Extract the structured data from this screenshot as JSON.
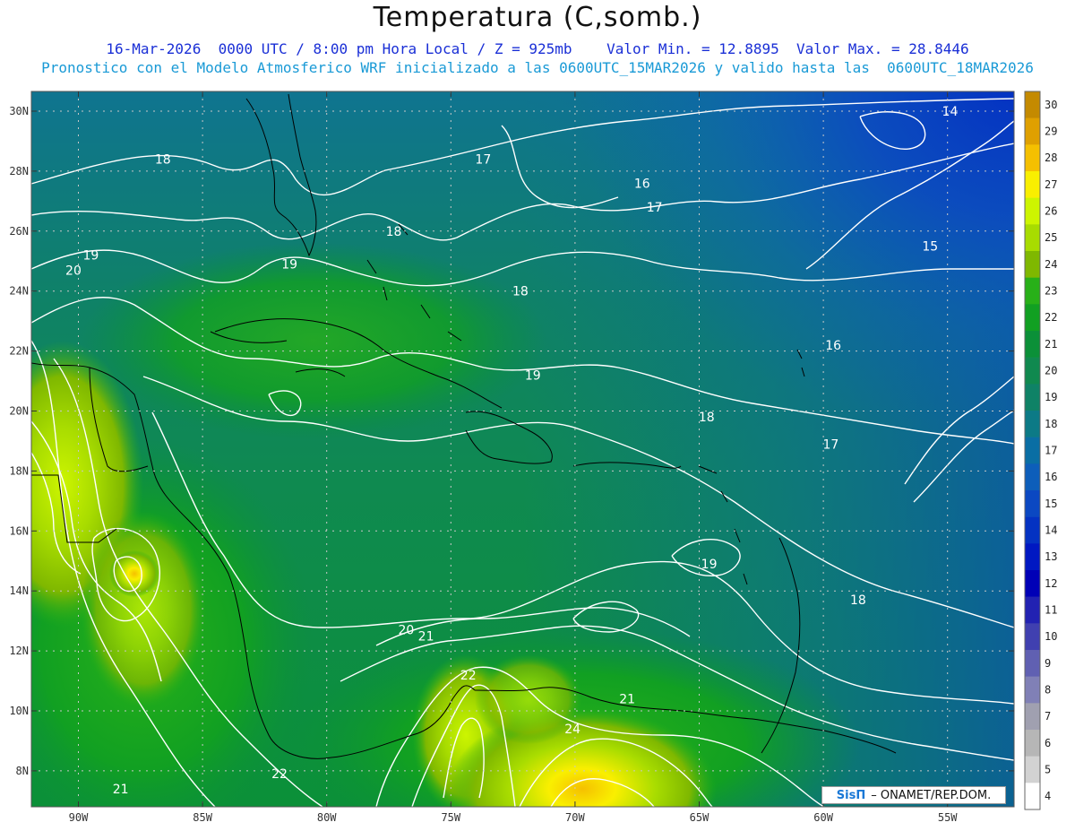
{
  "header": {
    "title": "Temperatura (C,somb.)",
    "line1": "16-Mar-2026  0000 UTC / 8:00 pm Hora Local / Z = 925mb    Valor Min. = 12.8895  Valor Max. = 28.8446",
    "line2": "Pronostico con el Modelo Atmosferico WRF inicializado a las 0600UTC_15MAR2026 y valido hasta las  0600UTC_18MAR2026"
  },
  "map": {
    "lat_ticks": [
      "30N",
      "28N",
      "26N",
      "24N",
      "22N",
      "20N",
      "18N",
      "16N",
      "14N",
      "12N",
      "10N",
      "8N"
    ],
    "lon_ticks": [
      "90W",
      "85W",
      "80W",
      "75W",
      "70W",
      "65W",
      "60W",
      "55W"
    ],
    "contour_labels": [
      {
        "text": "14",
        "lon": -54.9,
        "lat": 30.0
      },
      {
        "text": "15",
        "lon": -55.7,
        "lat": 25.5
      },
      {
        "text": "16",
        "lon": -67.3,
        "lat": 27.6
      },
      {
        "text": "16",
        "lon": -59.6,
        "lat": 22.2
      },
      {
        "text": "17",
        "lon": -73.7,
        "lat": 28.4
      },
      {
        "text": "17",
        "lon": -66.8,
        "lat": 26.8
      },
      {
        "text": "17",
        "lon": -59.7,
        "lat": 18.9
      },
      {
        "text": "18",
        "lon": -86.6,
        "lat": 28.4
      },
      {
        "text": "18",
        "lon": -77.3,
        "lat": 26.0
      },
      {
        "text": "18",
        "lon": -72.2,
        "lat": 24.0
      },
      {
        "text": "18",
        "lon": -64.7,
        "lat": 19.8
      },
      {
        "text": "18",
        "lon": -58.6,
        "lat": 13.7
      },
      {
        "text": "19",
        "lon": -89.5,
        "lat": 25.2
      },
      {
        "text": "19",
        "lon": -81.5,
        "lat": 24.9
      },
      {
        "text": "19",
        "lon": -71.7,
        "lat": 21.2
      },
      {
        "text": "19",
        "lon": -64.6,
        "lat": 14.9
      },
      {
        "text": "20",
        "lon": -90.2,
        "lat": 24.7
      },
      {
        "text": "20",
        "lon": -76.8,
        "lat": 12.7
      },
      {
        "text": "21",
        "lon": -76.0,
        "lat": 12.5
      },
      {
        "text": "21",
        "lon": -88.3,
        "lat": 7.4
      },
      {
        "text": "21",
        "lon": -67.9,
        "lat": 10.4
      },
      {
        "text": "22",
        "lon": -74.3,
        "lat": 11.2
      },
      {
        "text": "22",
        "lon": -81.9,
        "lat": 7.9
      },
      {
        "text": "24",
        "lon": -70.1,
        "lat": 9.4
      }
    ]
  },
  "colorbar": {
    "labels": [
      "30",
      "29",
      "28",
      "27",
      "26",
      "25",
      "24",
      "23",
      "22",
      "21",
      "20",
      "19",
      "18",
      "17",
      "16",
      "15",
      "14",
      "13",
      "12",
      "11",
      "10",
      "9",
      "8",
      "7",
      "6",
      "5",
      "4"
    ],
    "colors": [
      "#c48a00",
      "#dfa000",
      "#f5c000",
      "#f9ef00",
      "#cdf500",
      "#a8dc00",
      "#7fb800",
      "#28b018",
      "#11a022",
      "#0b9038",
      "#10894f",
      "#0f8266",
      "#0c7a86",
      "#0a6ea4",
      "#0d5eba",
      "#0b48c2",
      "#0432c2",
      "#0018c2",
      "#0000b6",
      "#2222b2",
      "#4040b0",
      "#6060b2",
      "#8080b6",
      "#a0a0b0",
      "#b6b6b6",
      "#d2d2d2",
      "#ffffff"
    ]
  },
  "credit": {
    "logo": "SisΠ",
    "text": "– ONAMET/REP.DOM."
  }
}
